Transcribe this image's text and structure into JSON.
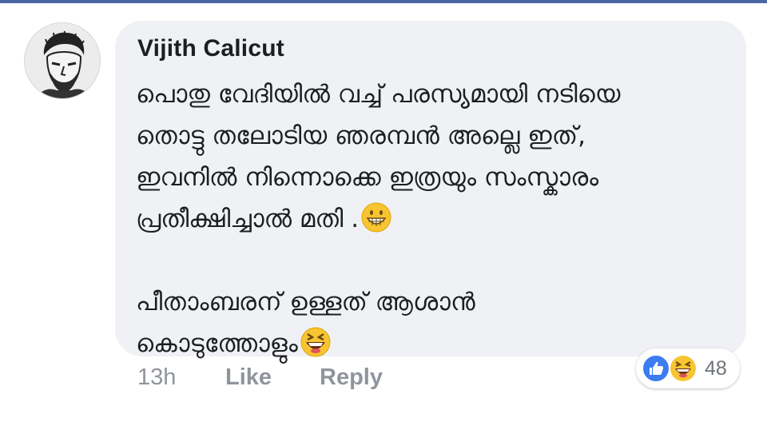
{
  "comment": {
    "author": "Vijith Calicut",
    "lines": [
      "പൊതു വേദിയിൽ വച്ച് പരസ്യമായി നടിയെ",
      "തൊട്ടു തലോടിയ ഞരമ്പൻ അല്ലെ ഇത്,",
      "ഇവനിൽ നിന്നൊക്കെ ഇത്രയും സംസ്കാരം",
      "പ്രതീക്ഷിച്ചാൽ മതി ."
    ],
    "lines_2": [
      "പീതാംബരന് ഉള്ളത് ആശാൻ",
      "കൊടുത്തോളും"
    ],
    "emoji_1": "grinning-face-emoji",
    "emoji_2": "laughing-face-emoji"
  },
  "actions": {
    "time": "13h",
    "like": "Like",
    "reply": "Reply"
  },
  "reactions": {
    "icons": [
      "like-icon",
      "haha-icon"
    ],
    "count": "48"
  },
  "colors": {
    "bubble": "#f0f1f4",
    "author": "#1c1e21",
    "meta": "#90949c",
    "like_blue": "#3b7cf0",
    "top_bar": "#4a67a5"
  }
}
